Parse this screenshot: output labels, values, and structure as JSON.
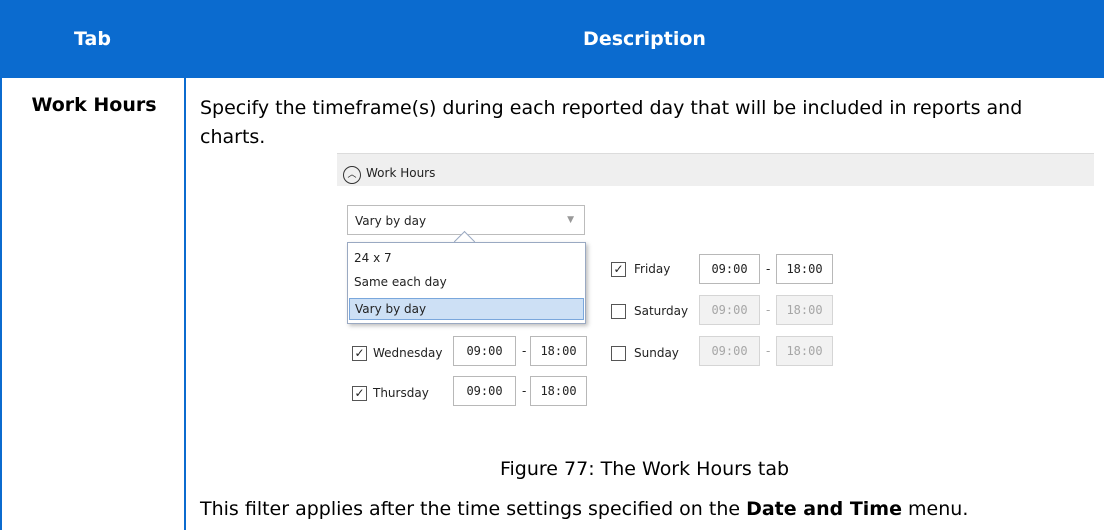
{
  "table": {
    "header": {
      "col1": "Tab",
      "col2": "Description"
    },
    "row": {
      "label": "Work Hours",
      "description": "Specify the timeframe(s) during each reported day that will be included in reports and charts.",
      "caption": "Figure 77: The Work Hours tab",
      "footnote_prefix": "This filter applies after the time settings specified on the ",
      "footnote_bold": "Date and Time",
      "footnote_suffix": " menu."
    }
  },
  "screenshot": {
    "section_title": "Work Hours",
    "section_toggle_icon": "chevron-up-icon",
    "dropdown": {
      "selected": "Vary by day",
      "options": [
        "24 x 7",
        "Same each day",
        "Vary by day"
      ]
    },
    "days": {
      "wednesday": {
        "label": "Wednesday",
        "checked": true,
        "start": "09:00",
        "end": "18:00"
      },
      "thursday": {
        "label": "Thursday",
        "checked": true,
        "start": "09:00",
        "end": "18:00"
      },
      "friday": {
        "label": "Friday",
        "checked": true,
        "start": "09:00",
        "end": "18:00"
      },
      "saturday": {
        "label": "Saturday",
        "checked": false,
        "start": "09:00",
        "end": "18:00"
      },
      "sunday": {
        "label": "Sunday",
        "checked": false,
        "start": "09:00",
        "end": "18:00"
      }
    },
    "separator": "-",
    "check_mark": "✓"
  },
  "colors": {
    "header_bg": "#0b6bcf",
    "selected_option_bg": "#cde0f5"
  }
}
